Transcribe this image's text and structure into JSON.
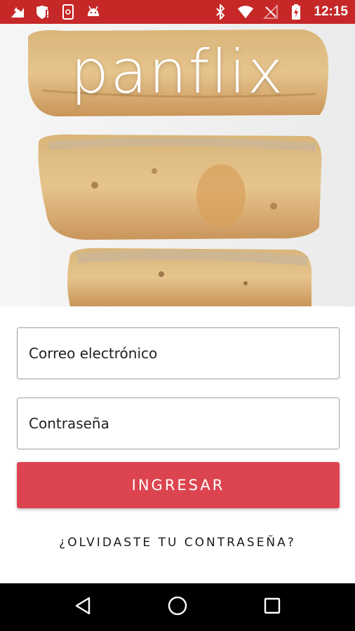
{
  "status_bar": {
    "time": "12:15",
    "left_icons": [
      "upload-notification-icon",
      "shield-alert-icon",
      "phone-sync-icon",
      "android-icon"
    ],
    "right_icons": [
      "bluetooth-icon",
      "wifi-icon",
      "no-signal-icon",
      "battery-charging-icon"
    ],
    "color": "#c62828"
  },
  "hero": {
    "logo_text": "panflix",
    "image_subject": "bread-slices"
  },
  "form": {
    "email_placeholder": "Correo electrónico",
    "password_placeholder": "Contraseña",
    "login_button_label": "INGRESAR",
    "forgot_password_label": "¿OLVIDASTE TU CONTRASEÑA?",
    "accent_color": "#dc4550"
  },
  "nav_bar": {
    "buttons": [
      "back-icon",
      "home-icon",
      "recents-icon"
    ]
  }
}
